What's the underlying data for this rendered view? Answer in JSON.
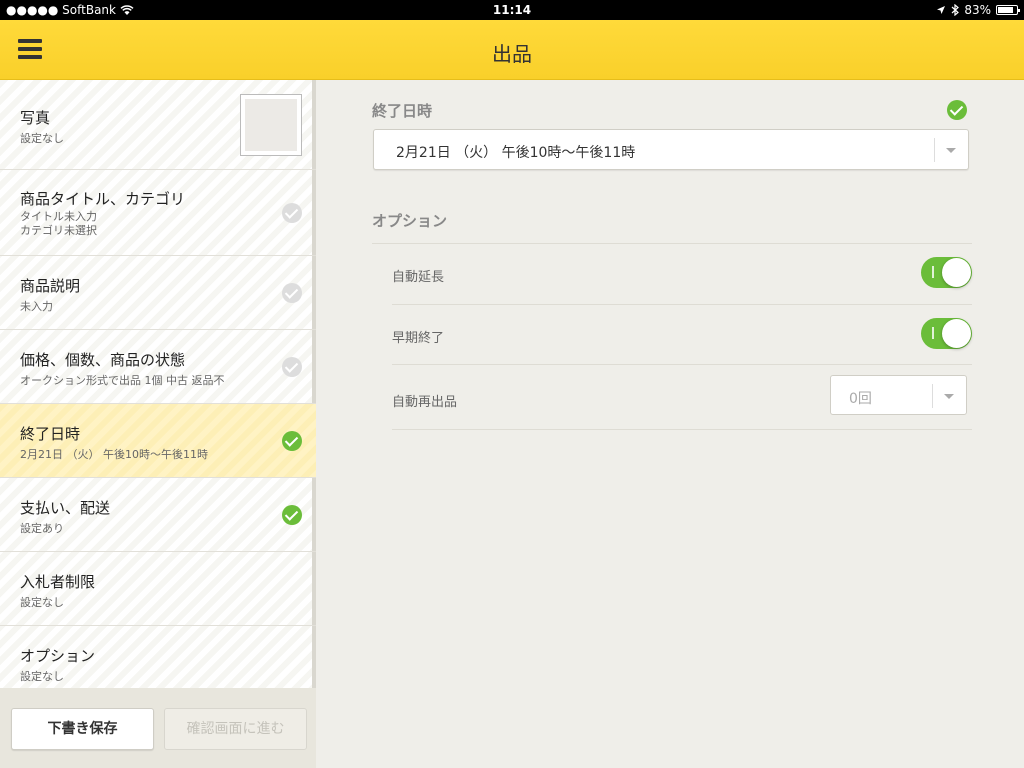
{
  "status_bar": {
    "carrier": "●●●●● SoftBank",
    "time": "11:14",
    "battery": "83%",
    "battery_level": 0.83
  },
  "header": {
    "title": "出品"
  },
  "sidebar": {
    "items": [
      {
        "title": "写真",
        "sub": "設定なし",
        "status": "photo"
      },
      {
        "title": "商品タイトル、カテゴリ",
        "sub": "タイトル未入力",
        "sub2": "カテゴリ未選択",
        "status": "incomplete"
      },
      {
        "title": "商品説明",
        "sub": "未入力",
        "status": "incomplete"
      },
      {
        "title": "価格、個数、商品の状態",
        "sub": "オークション形式で出品 1個  中古 返品不",
        "status": "incomplete"
      },
      {
        "title": "終了日時",
        "sub": " 2月21日 （火） 午後10時〜午後11時",
        "status": "complete",
        "active": true
      },
      {
        "title": "支払い、配送",
        "sub": "設定あり",
        "status": "complete"
      },
      {
        "title": "入札者制限",
        "sub": "設定なし",
        "status": "none"
      },
      {
        "title": "オプション",
        "sub": "設定なし",
        "status": "none"
      }
    ],
    "draft_button": "下書き保存",
    "confirm_button": "確認画面に進む"
  },
  "main": {
    "end_date_label": "終了日時",
    "end_date_value": "2月21日 （火） 午後10時〜午後11時",
    "options_label": "オプション",
    "options": [
      {
        "label": "自動延長",
        "type": "toggle",
        "on": true
      },
      {
        "label": "早期終了",
        "type": "toggle",
        "on": true
      },
      {
        "label": "自動再出品",
        "type": "select",
        "value": "0回"
      }
    ]
  },
  "colors": {
    "accent_yellow": "#ffd83a",
    "check_green": "#6bbd3a",
    "active_row": "#fff0b8"
  }
}
